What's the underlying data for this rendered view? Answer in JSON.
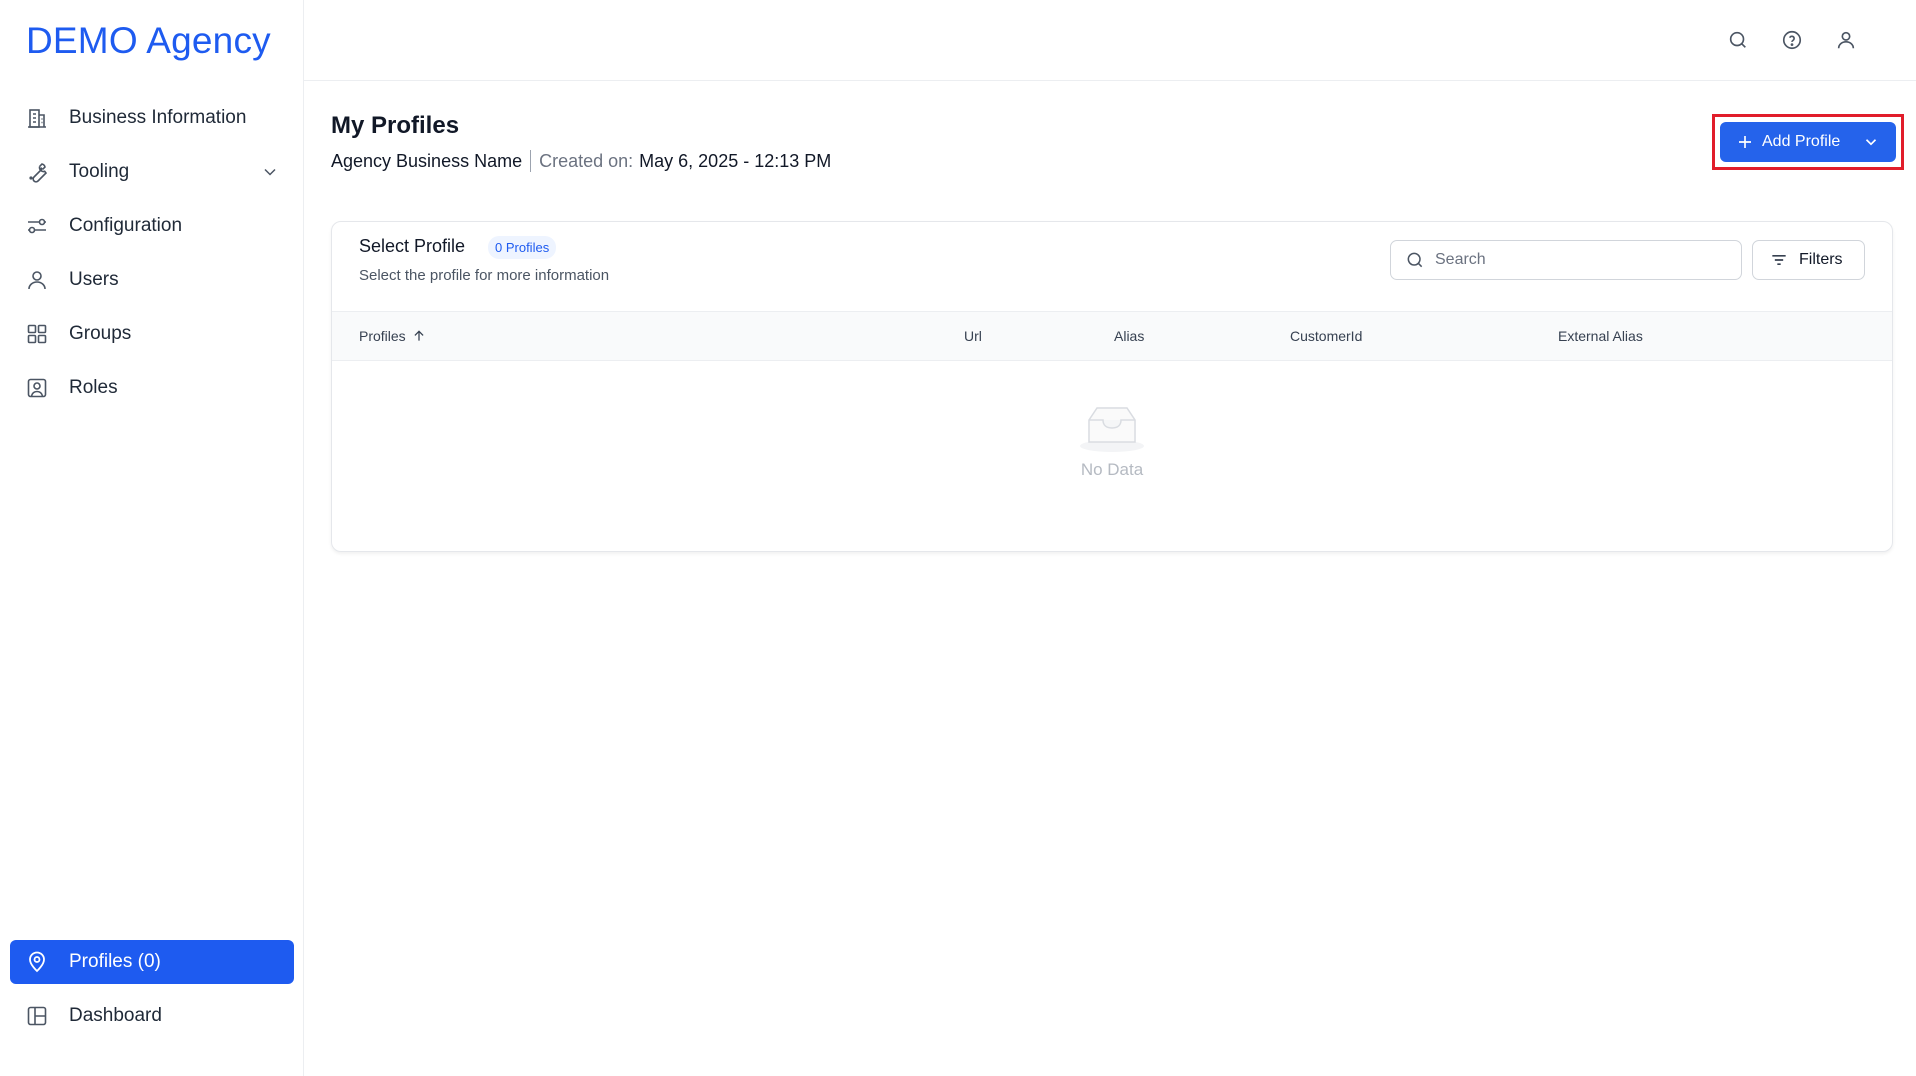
{
  "brand": "DEMO Agency",
  "nav": [
    {
      "name": "nav-business-information",
      "label": "Business Information",
      "icon": "building-icon"
    },
    {
      "name": "nav-tooling",
      "label": "Tooling",
      "icon": "wrench-icon",
      "expandable": true
    },
    {
      "name": "nav-configuration",
      "label": "Configuration",
      "icon": "sliders-icon"
    },
    {
      "name": "nav-users",
      "label": "Users",
      "icon": "user-icon"
    },
    {
      "name": "nav-groups",
      "label": "Groups",
      "icon": "grid-icon"
    },
    {
      "name": "nav-roles",
      "label": "Roles",
      "icon": "id-card-icon"
    }
  ],
  "nav_bottom": [
    {
      "name": "nav-profiles",
      "label": "Profiles (0)",
      "icon": "location-pin-icon",
      "active": true
    },
    {
      "name": "nav-dashboard",
      "label": "Dashboard",
      "icon": "layout-icon"
    }
  ],
  "topbar": {
    "icons": [
      "search-icon",
      "help-circle-icon",
      "account-icon"
    ]
  },
  "page": {
    "title": "My Profiles",
    "business_name": "Agency Business Name",
    "created_label": "Created on:",
    "created_value": "May 6, 2025 - 12:13 PM",
    "add_button_label": "Add Profile"
  },
  "card": {
    "title": "Select Profile",
    "count_badge": "0 Profiles",
    "subtitle": "Select the profile for more information",
    "search_placeholder": "Search",
    "filters_label": "Filters",
    "columns": [
      "Profiles",
      "Url",
      "Alias",
      "CustomerId",
      "External Alias"
    ],
    "empty_text": "No Data"
  },
  "colors": {
    "accent": "#1e5bf0",
    "highlight_border": "#e11d2a"
  }
}
